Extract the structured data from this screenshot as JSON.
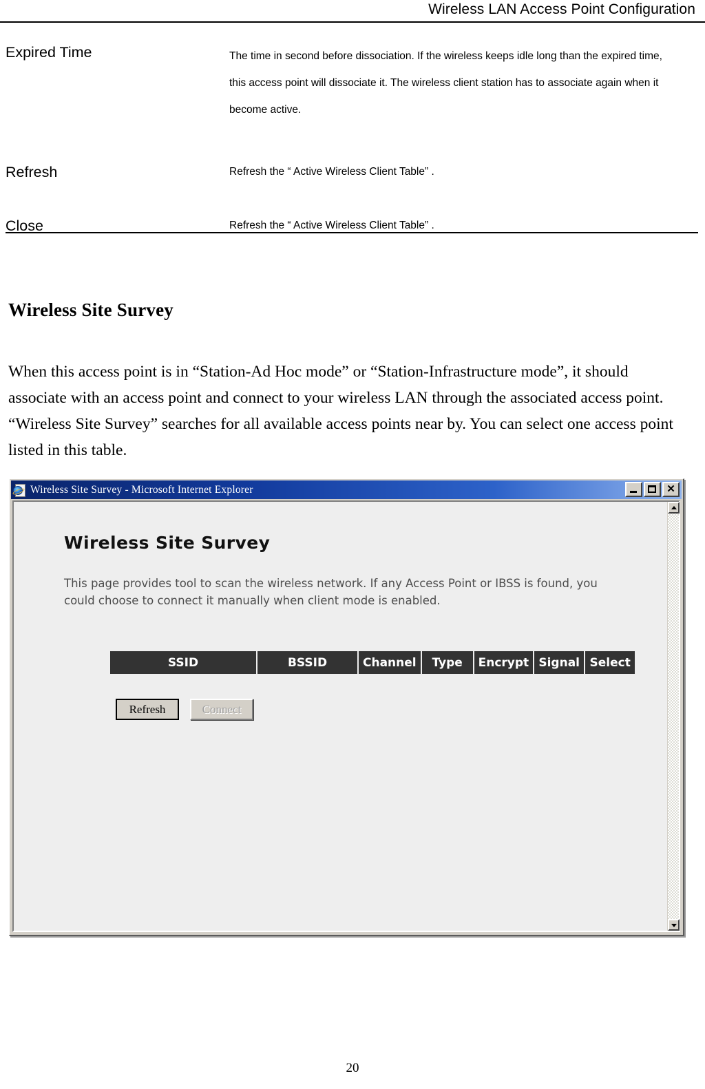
{
  "header": {
    "running_title": "Wireless LAN Access Point Configuration"
  },
  "definitions": [
    {
      "term": "Expired Time",
      "description": "The time in second before dissociation. If the wireless keeps idle long than the expired time, this access point will dissociate it. The wireless client station has to associate again when it become active."
    },
    {
      "term": "Refresh",
      "description": "Refresh the “ Active Wireless Client Table” ."
    },
    {
      "term": "Close",
      "description": "Refresh the “ Active Wireless Client Table” ."
    }
  ],
  "section": {
    "title": "Wireless Site Survey",
    "paragraph": "When this access point is in “Station-Ad Hoc mode” or “Station-Infrastructure mode”, it should associate with an access point and connect to your wireless LAN through the associated access point. “Wireless Site Survey” searches for all available access points near by. You can select one access point listed in this table."
  },
  "browser": {
    "title_bar": {
      "title": "Wireless Site Survey - Microsoft Internet Explorer",
      "icon": "internet-explorer-icon",
      "minimize_label": "",
      "maximize_label": "",
      "close_label": "✕"
    },
    "page": {
      "heading": "Wireless Site Survey",
      "intro": "This page provides tool to scan the wireless network. If any Access Point or IBSS is found, you could choose to connect it manually when client mode is enabled.",
      "table": {
        "columns": [
          "SSID",
          "BSSID",
          "Channel",
          "Type",
          "Encrypt",
          "Signal",
          "Select"
        ],
        "rows": [],
        "header_bg": "#333333",
        "header_fg": "#ffffff"
      },
      "buttons": [
        {
          "label": "Refresh",
          "state": "enabled"
        },
        {
          "label": "Connect",
          "state": "disabled"
        }
      ]
    },
    "scrollbar": {
      "up_arrow": "scroll-up-icon",
      "down_arrow": "scroll-down-icon"
    }
  },
  "footer": {
    "page_number": "20"
  }
}
